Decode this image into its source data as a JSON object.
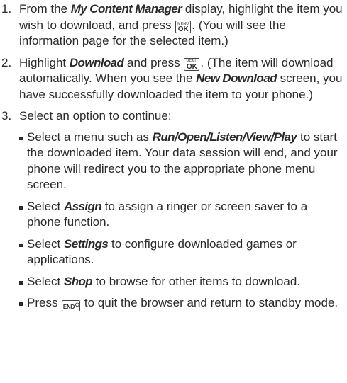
{
  "keys": {
    "menu_ok_top": "MENU",
    "menu_ok_main": "OK",
    "end_label": "END",
    "power_symbol": "⏻"
  },
  "steps": [
    {
      "number": "1.",
      "t1": "From the ",
      "e1": "My Content Manager",
      "t2": " display, highlight the item you wish to download, and press ",
      "t3": ". (You will see the information page for the selected item.)"
    },
    {
      "number": "2.",
      "t1": "Highlight ",
      "e1": "Download",
      "t2": " and press ",
      "t3": ". (The item will download automatically. When you see the ",
      "e2": "New Download",
      "t4": " screen, you have successfully downloaded the item to your phone.)"
    },
    {
      "number": "3.",
      "t1": "Select an option to continue:"
    }
  ],
  "options": [
    {
      "t1": "Select a menu such as ",
      "e1": "Run/Open/Listen/View/Play",
      "t2": " to start the downloaded item. Your data session will end, and your phone will redirect you to the appropriate phone menu screen."
    },
    {
      "t1": "Select ",
      "e1": "Assign",
      "t2": " to assign a ringer or screen saver to a phone function."
    },
    {
      "t1": "Select ",
      "e1": "Settings",
      "t2": " to configure downloaded games or applications."
    },
    {
      "t1": "Select ",
      "e1": "Shop",
      "t2": " to browse for other items to download."
    },
    {
      "t1": "Press ",
      "t2": " to quit the browser and return to standby mode."
    }
  ]
}
